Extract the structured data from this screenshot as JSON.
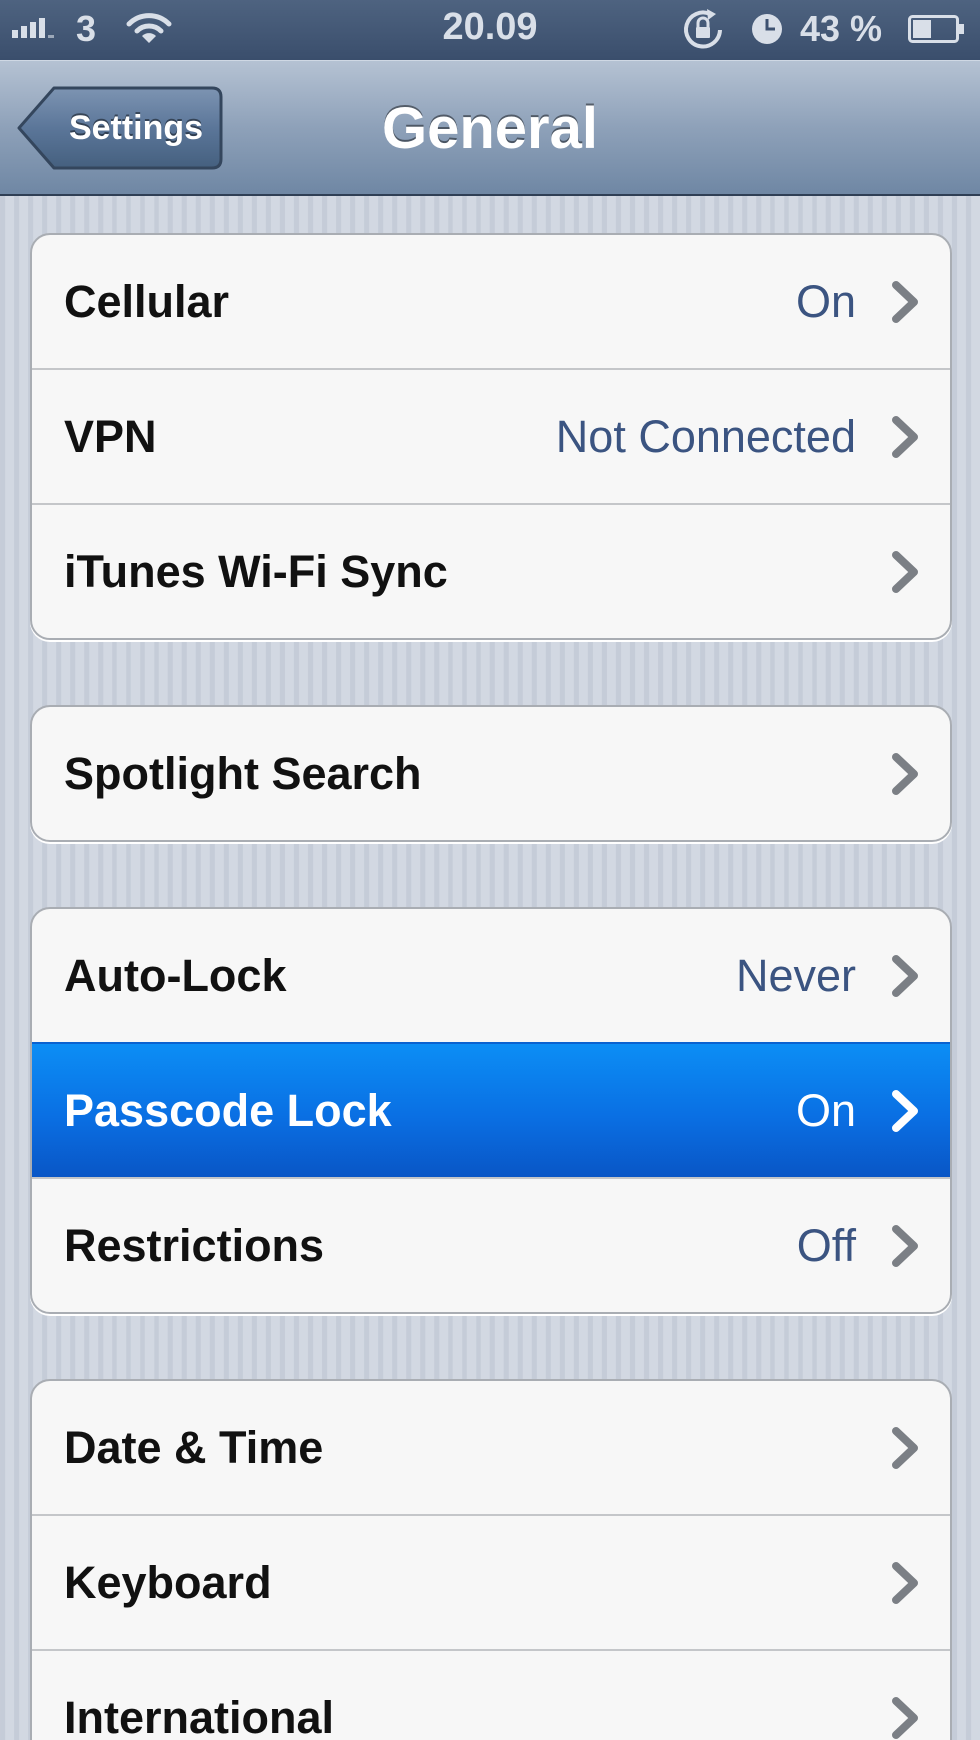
{
  "status_bar": {
    "carrier": "3",
    "time": "20.09",
    "battery_percent": "43 %",
    "battery_level": 0.43,
    "icons": [
      "signal-bars-icon",
      "wifi-icon",
      "rotation-lock-icon",
      "alarm-clock-icon",
      "battery-icon"
    ]
  },
  "nav": {
    "back_label": "Settings",
    "title": "General"
  },
  "groups": [
    [
      {
        "label": "Cellular",
        "value": "On"
      },
      {
        "label": "VPN",
        "value": "Not Connected"
      },
      {
        "label": "iTunes Wi-Fi Sync",
        "value": ""
      }
    ],
    [
      {
        "label": "Spotlight Search",
        "value": ""
      }
    ],
    [
      {
        "label": "Auto-Lock",
        "value": "Never"
      },
      {
        "label": "Passcode Lock",
        "value": "On",
        "selected": true
      },
      {
        "label": "Restrictions",
        "value": "Off"
      }
    ],
    [
      {
        "label": "Date & Time",
        "value": ""
      },
      {
        "label": "Keyboard",
        "value": ""
      },
      {
        "label": "International",
        "value": ""
      }
    ]
  ],
  "colors": {
    "selection": "#0a6fe3",
    "value_text": "#3b5481",
    "nav_bar": "#8ea1b9"
  }
}
